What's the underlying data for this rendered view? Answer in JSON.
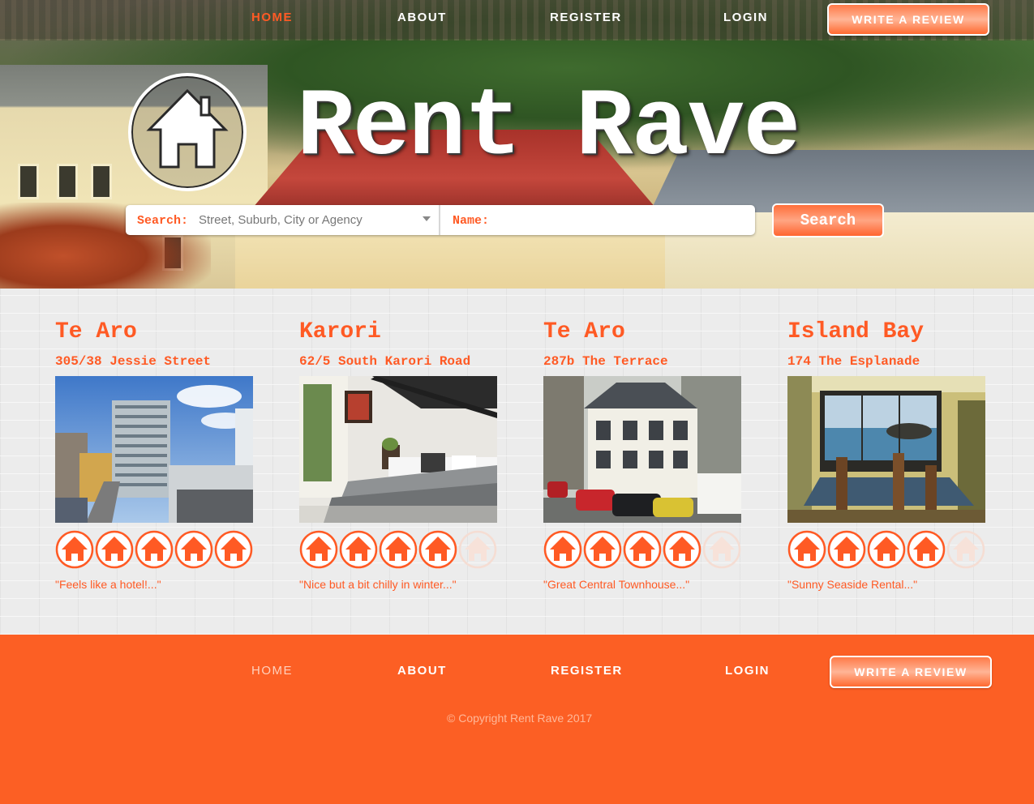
{
  "nav": {
    "items": [
      {
        "label": "HOME",
        "active": true
      },
      {
        "label": "ABOUT",
        "active": false
      },
      {
        "label": "REGISTER",
        "active": false
      },
      {
        "label": "LOGIN",
        "active": false
      }
    ],
    "cta_label": "WRITE A REVIEW"
  },
  "brand": {
    "name": "Rent Rave",
    "logo_icon": "house-icon"
  },
  "search": {
    "search_label": "Search:",
    "search_placeholder": "Street, Suburb, City or Agency",
    "name_label": "Name:",
    "name_value": "",
    "button_label": "Search"
  },
  "listings": [
    {
      "suburb": "Te Aro",
      "address": "305/38 Jessie Street",
      "rating": 5,
      "max_rating": 5,
      "quote": "\"Feels like a hotel!...\"",
      "photo": "apartment-tower-photo"
    },
    {
      "suburb": "Karori",
      "address": "62/5 South Karori Road",
      "rating": 4,
      "max_rating": 5,
      "quote": "\"Nice but a bit chilly in winter...\"",
      "photo": "bedroom-photo"
    },
    {
      "suburb": "Te Aro",
      "address": "287b The Terrace",
      "rating": 4,
      "max_rating": 5,
      "quote": "\"Great Central Townhouse...\"",
      "photo": "townhouse-photo"
    },
    {
      "suburb": "Island Bay",
      "address": "174 The Esplanade",
      "rating": 4,
      "max_rating": 5,
      "quote": "\"Sunny Seaside Rental...\"",
      "photo": "seaside-dining-photo"
    }
  ],
  "footer": {
    "copyright": "© Copyright Rent Rave 2017"
  },
  "colors": {
    "accent": "#ff5a24",
    "footer_bg": "#fc5f24",
    "page_bg": "#ececec"
  }
}
